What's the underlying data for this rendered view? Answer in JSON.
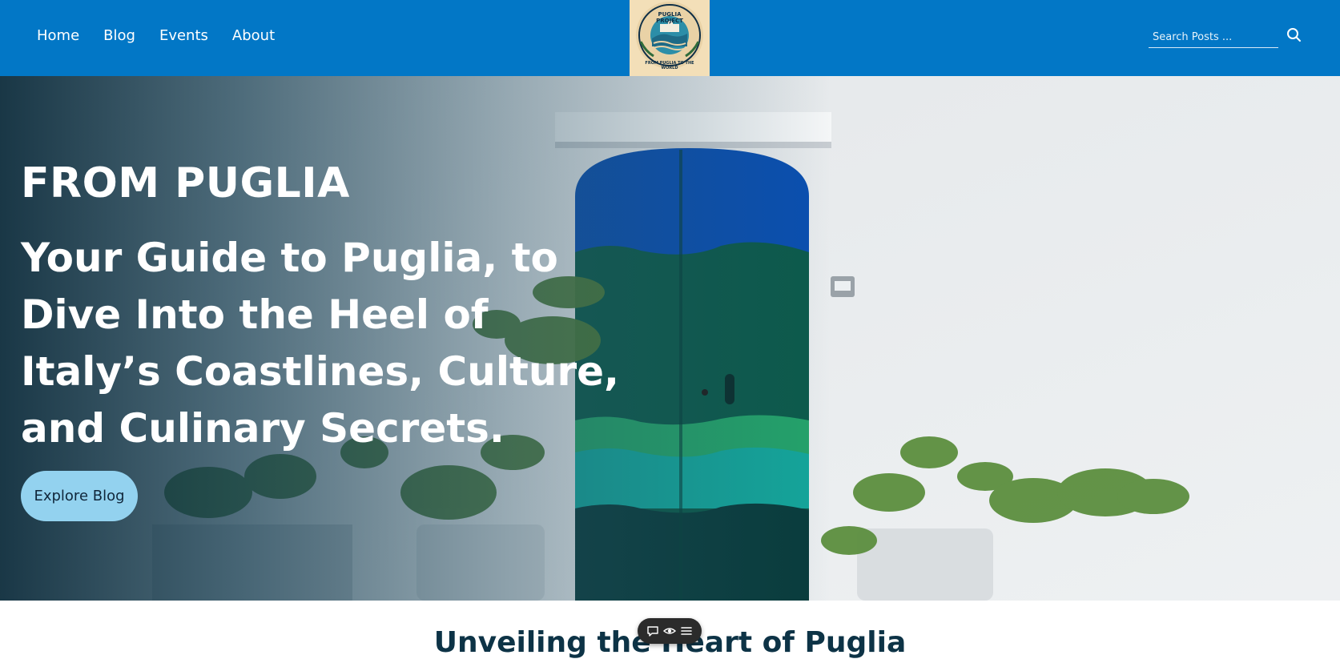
{
  "nav": {
    "items": [
      {
        "label": "Home"
      },
      {
        "label": "Blog"
      },
      {
        "label": "Events"
      },
      {
        "label": "About"
      }
    ]
  },
  "logo": {
    "text_top": "PUGLIA PROJECT",
    "text_bottom": "FROM PUGLIA TO THE WORLD"
  },
  "search": {
    "placeholder": "Search Posts ...",
    "icon": "search-icon"
  },
  "hero": {
    "kicker": "FROM PUGLIA",
    "title": "Your Guide to Puglia, to Dive Into the Heel of Italy’s Coastlines, Culture, and Culinary Secrets.",
    "cta_label": "Explore Blog"
  },
  "section": {
    "title": "Unveiling the Heart of Puglia"
  },
  "floating_toolbar": {
    "icons": [
      "comment-icon",
      "eye-icon",
      "menu-icon"
    ]
  },
  "colors": {
    "header_bg": "#0277c6",
    "cta_bg": "#93d2ef",
    "section_title": "#0d3346",
    "door_blue": "#0a4fb0",
    "door_green": "#1f7f4a"
  }
}
